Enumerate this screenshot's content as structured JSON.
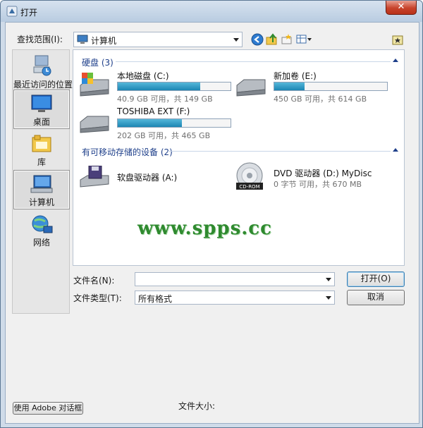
{
  "window": {
    "title": "打开",
    "close_symbol": "✕"
  },
  "lookin": {
    "label": "查找范围(I):",
    "value": "计算机"
  },
  "toolbar": {
    "icons": [
      "back-icon",
      "up-folder-icon",
      "new-folder-icon",
      "view-menu-icon",
      "favorites-folder-icon"
    ]
  },
  "places": [
    {
      "label": "最近访问的位置",
      "icon": "recent-places-icon"
    },
    {
      "label": "桌面",
      "icon": "desktop-icon"
    },
    {
      "label": "库",
      "icon": "libraries-icon"
    },
    {
      "label": "计算机",
      "icon": "computer-icon"
    },
    {
      "label": "网络",
      "icon": "network-icon"
    }
  ],
  "groups": {
    "hard_disks": {
      "header": "硬盘 (3)",
      "drives": [
        {
          "name": "本地磁盘 (C:)",
          "info": "40.9 GB 可用，共 149 GB",
          "used_fraction": 0.73
        },
        {
          "name": "新加卷 (E:)",
          "info": "450 GB 可用，共 614 GB",
          "used_fraction": 0.27
        },
        {
          "name": "TOSHIBA EXT (F:)",
          "info": "202 GB 可用，共 465 GB",
          "used_fraction": 0.57
        }
      ]
    },
    "removable": {
      "header": "有可移动存储的设备 (2)",
      "devices": [
        {
          "name": "软盘驱动器 (A:)"
        },
        {
          "name": "DVD 驱动器 (D:) MyDisc",
          "info": "0 字节 可用，共 670 MB",
          "disc_label": "CD-ROM"
        }
      ]
    }
  },
  "watermark": "www.spps.cc",
  "form": {
    "filename_label": "文件名(N):",
    "filename_value": "",
    "filetype_label": "文件类型(T):",
    "filetype_value": "所有格式",
    "open_button": "打开(O)",
    "cancel_button": "取消",
    "adobe_button": "使用 Adobe 对话框",
    "size_label": "文件大小:"
  },
  "colors": {
    "drive_bar": "#1c86b3",
    "group_header": "#1e3f8a",
    "watermark": "#2f8a2f"
  }
}
